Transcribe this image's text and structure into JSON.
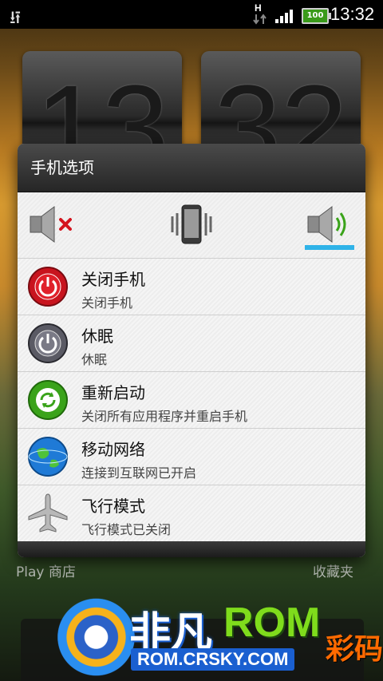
{
  "status_bar": {
    "network_type": "H",
    "battery": "100",
    "time": "13:32"
  },
  "background": {
    "clock_hour": "13",
    "clock_minute": "32",
    "label_left": "Play 商店",
    "label_right": "收藏夹"
  },
  "dialog": {
    "title": "手机选项",
    "sound_modes": [
      {
        "name": "mute-icon",
        "selected": false
      },
      {
        "name": "vibrate-icon",
        "selected": false
      },
      {
        "name": "sound-on-icon",
        "selected": true
      }
    ],
    "items": [
      {
        "title": "关闭手机",
        "subtitle": "关闭手机",
        "icon": "power-off-icon"
      },
      {
        "title": "休眠",
        "subtitle": "休眠",
        "icon": "sleep-icon"
      },
      {
        "title": "重新启动",
        "subtitle": "关闭所有应用程序并重启手机",
        "icon": "restart-icon"
      },
      {
        "title": "移动网络",
        "subtitle": "连接到互联网已开启",
        "icon": "globe-icon"
      },
      {
        "title": "飞行模式",
        "subtitle": "飞行模式已关闭",
        "icon": "airplane-icon"
      }
    ]
  },
  "watermark": {
    "title_cn": "非凡",
    "title_en": "ROM",
    "url": "ROM.CRSKY.COM",
    "side": "彩码"
  },
  "colors": {
    "accent": "#2fb3e8",
    "power_red": "#c8141e",
    "restart_green": "#3aa31a"
  }
}
